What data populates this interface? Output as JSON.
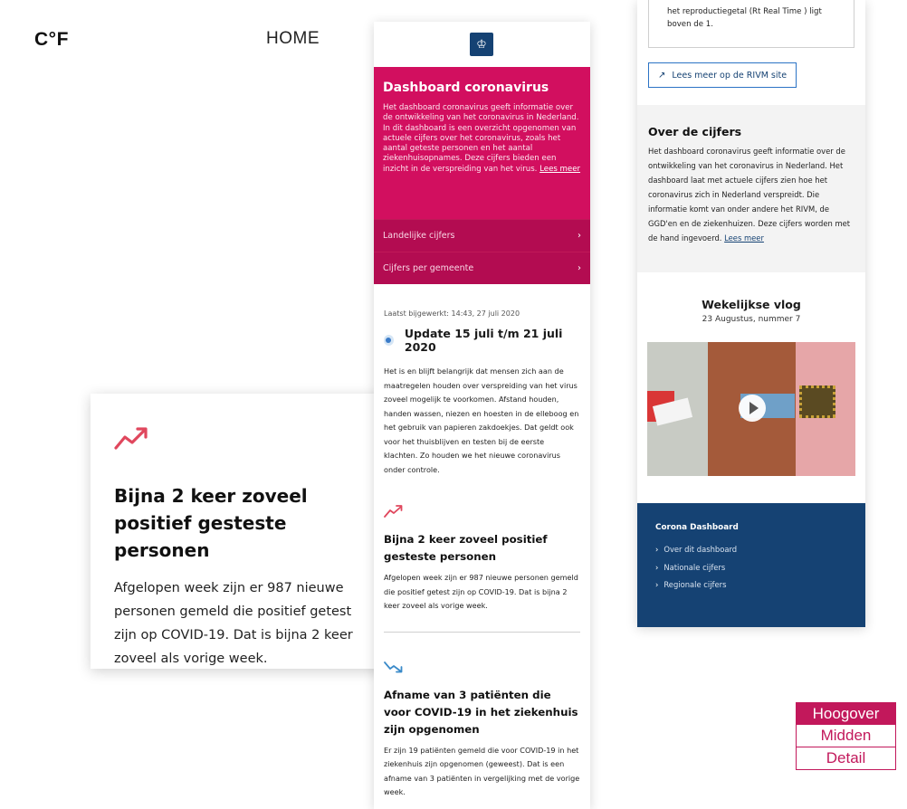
{
  "brand": {
    "logo": "C°F"
  },
  "nav": {
    "home": "HOME"
  },
  "big_card": {
    "title": "Bijna 2 keer zoveel positief gesteste personen",
    "body": "Afgelopen week zijn er 987 nieuwe personen gemeld die positief getest zijn op COVID-19. Dat is bijna 2 keer zoveel als vorige week."
  },
  "mid_phone": {
    "crest_icon": "rijksoverheid-crest-icon",
    "hero": {
      "title": "Dashboard coronavirus",
      "body": "Het dashboard coronavirus geeft informatie over de ontwikkeling van het coronavirus in Nederland. In dit dashboard is een overzicht opgenomen van actuele cijfers over het coronavirus, zoals het aantal geteste personen en het aantal ziekenhuisopnames. Deze cijfers bieden een inzicht in de verspreiding van het virus.",
      "link": "Lees meer"
    },
    "menu": [
      "Landelijke cijfers",
      "Cijfers per gemeente"
    ],
    "updated": "Laatst bijgewerkt: 14:43, 27 juli 2020",
    "update_title": "Update 15 juli t/m 21 juli 2020",
    "update_text": "Het is en blijft belangrijk dat mensen zich aan de maatregelen houden over verspreiding van het virus zoveel mogelijk te voorkomen. Afstand houden, handen wassen, niezen en hoesten in de elleboog en het gebruik van papieren zakdoekjes. Dat geldt ook voor het thuisblijven en testen bij de eerste klachten. Zo houden we het nieuwe coronavirus onder controle.",
    "section1": {
      "title": "Bijna 2 keer zoveel positief gesteste personen",
      "body": "Afgelopen week zijn er 987 nieuwe personen gemeld die positief getest zijn op COVID-19. Dat is bijna 2 keer zoveel als vorige week."
    },
    "section2": {
      "title": "Afname van 3 patiënten die voor COVID-19 in het ziekenhuis zijn opgenomen",
      "body": "Er zijn 19 patiënten gemeld die voor COVID-19 in het ziekenhuis zijn opgenomen (geweest). Dat is een afname van 3 patiënten in vergelijking met de vorige week."
    }
  },
  "right_phone": {
    "quote": "het reproductiegetal (Rt Real Time ) ligt boven de 1.",
    "rivm_link": "Lees meer op de RIVM site",
    "about": {
      "title": "Over de cijfers",
      "body": "Het dashboard coronavirus geeft informatie over de ontwikkeling van het coronavirus in Nederland. Het dashboard laat met actuele cijfers zien hoe het coronavirus zich in Nederland verspreidt. Die informatie komt van onder andere het RIVM, de GGD'en en de ziekenhuizen. Deze cijfers worden met de hand ingevoerd.",
      "link": "Lees meer"
    },
    "vlog": {
      "title": "Wekelijkse vlog",
      "subtitle": "23 Augustus, nummer 7"
    },
    "footer": {
      "title": "Corona Dashboard",
      "links": [
        "Over dit dashboard",
        "Nationale cijfers",
        "Regionale cijfers"
      ]
    }
  },
  "tabs": [
    "Hoogover",
    "Midden",
    "Detail"
  ],
  "colors": {
    "magenta": "#d20f5f",
    "navy": "#154273",
    "trend_up": "#e0475d",
    "trend_down": "#3a8ac9"
  }
}
